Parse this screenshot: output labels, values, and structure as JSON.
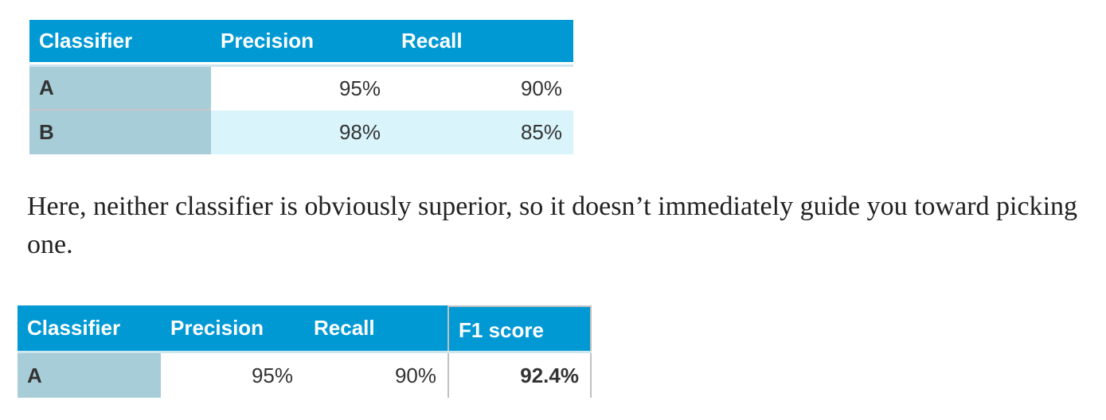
{
  "table1": {
    "headers": [
      "Classifier",
      "Precision",
      "Recall"
    ],
    "rows": [
      {
        "classifier": "A",
        "precision": "95%",
        "recall": "90%"
      },
      {
        "classifier": "B",
        "precision": "98%",
        "recall": "85%"
      }
    ]
  },
  "paragraph": "Here, neither classifier is obviously superior, so it doesn’t immediately guide you toward picking one.",
  "table2": {
    "headers": [
      "Classifier",
      "Precision",
      "Recall",
      "F1 score"
    ],
    "rows": [
      {
        "classifier": "A",
        "precision": "95%",
        "recall": "90%",
        "f1": "92.4%"
      }
    ]
  },
  "colors": {
    "header_bg": "#0099d4",
    "row_label_bg": "#a7cdd8",
    "tint_row_bg": "#d9f4fa"
  }
}
